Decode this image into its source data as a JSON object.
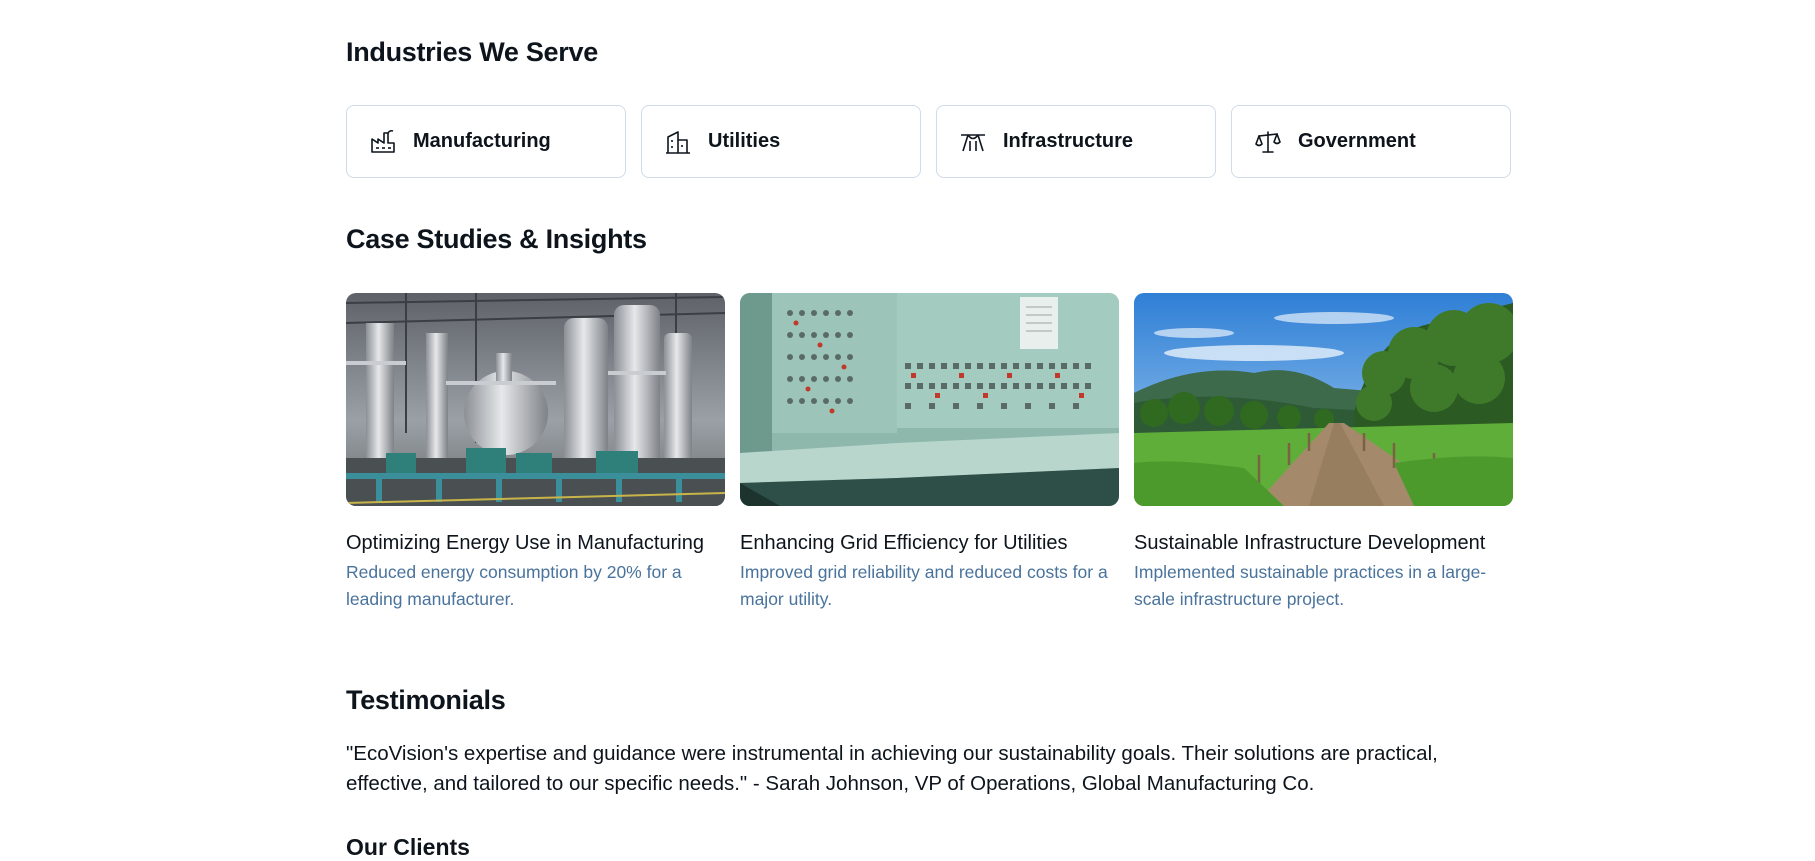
{
  "industries": {
    "title": "Industries We Serve",
    "items": [
      {
        "label": "Manufacturing",
        "icon": "factory-icon"
      },
      {
        "label": "Utilities",
        "icon": "buildings-icon"
      },
      {
        "label": "Infrastructure",
        "icon": "bridge-icon"
      },
      {
        "label": "Government",
        "icon": "scales-icon"
      }
    ]
  },
  "case_studies": {
    "title": "Case Studies & Insights",
    "items": [
      {
        "title": "Optimizing Energy Use in Manufacturing",
        "description": "Reduced energy consumption by 20% for a leading manufacturer.",
        "image": "factory-interior-image"
      },
      {
        "title": "Enhancing Grid Efficiency for Utilities",
        "description": "Improved grid reliability and reduced costs for a major utility.",
        "image": "control-room-image"
      },
      {
        "title": "Sustainable Infrastructure Development",
        "description": "Implemented sustainable practices in a large-scale infrastructure project.",
        "image": "green-path-image"
      }
    ]
  },
  "testimonials": {
    "title": "Testimonials",
    "quote": "\"EcoVision's expertise and guidance were instrumental in achieving our sustainability goals. Their solutions are practical, effective, and tailored to our specific needs.\" - Sarah Johnson, VP of Operations, Global Manufacturing Co."
  },
  "clients": {
    "title": "Our Clients"
  },
  "colors": {
    "text_primary": "#0d141c",
    "text_secondary": "#49739c",
    "card_border": "#cfdbe8",
    "background": "#ffffff"
  }
}
